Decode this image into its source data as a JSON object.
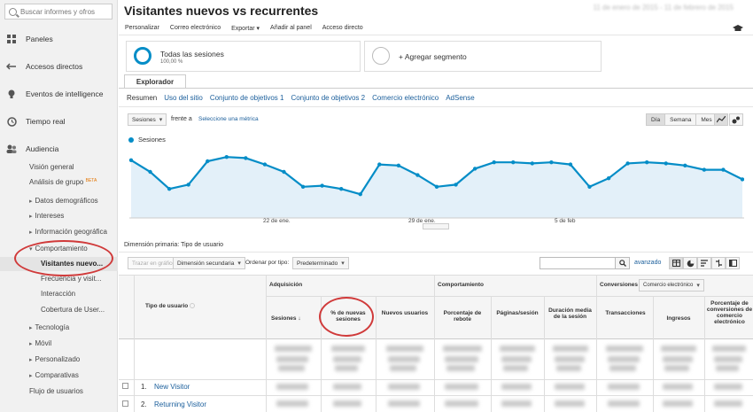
{
  "sidebar": {
    "search_placeholder": "Buscar informes y ofros",
    "items": [
      {
        "label": "Paneles",
        "icon": "grid-icon"
      },
      {
        "label": "Accesos directos",
        "icon": "shortcut-arrow-icon"
      },
      {
        "label": "Eventos de intelligence",
        "icon": "lightbulb-icon"
      },
      {
        "label": "Tiempo real",
        "icon": "clock-icon"
      },
      {
        "label": "Audiencia",
        "icon": "people-icon"
      }
    ],
    "audience_sub": {
      "overview": "Visión general",
      "cohort": "Análisis de grupo",
      "cohort_badge": "BETA",
      "demographics": "Datos demográficos",
      "interests": "Intereses",
      "geo": "Información geográfica",
      "behavior": "Comportamiento",
      "behavior_children": [
        "Visitantes nuevo...",
        "Frecuencia y visit...",
        "Interacción",
        "Cobertura de User..."
      ],
      "technology": "Tecnología",
      "mobile": "Móvil",
      "custom": "Personalizado",
      "benchmarking": "Comparativas",
      "users_flow": "Flujo de usuarios"
    }
  },
  "header": {
    "title": "Visitantes nuevos vs recurrentes",
    "date_range": "11 de enero de 2015 - 11 de febrero de 2015"
  },
  "toolbar": [
    "Personalizar",
    "Correo electrónico",
    "Exportar ▾",
    "Añadir al panel",
    "Acceso directo"
  ],
  "segments": {
    "all_sessions": "Todas las sesiones",
    "all_sessions_pct": "100,00 %",
    "add_segment": "+ Agregar segmento"
  },
  "explorer": {
    "tab": "Explorador",
    "subtabs": [
      "Resumen",
      "Uso del sitio",
      "Conjunto de objetivos 1",
      "Conjunto de objetivos 2",
      "Comercio electrónico",
      "AdSense"
    ]
  },
  "chart_controls": {
    "metric": "Sesiones",
    "versus": "frente a",
    "select_metric": "Seleccione una métrica",
    "periods": [
      "Día",
      "Semana",
      "Mes"
    ]
  },
  "chart_data": {
    "type": "area",
    "series": [
      {
        "name": "Sesiones",
        "values": [
          56,
          45,
          29,
          33,
          55,
          59,
          58,
          52,
          45,
          31,
          32,
          29,
          24,
          52,
          51,
          42,
          31,
          33,
          48,
          54,
          54,
          53,
          54,
          52,
          31,
          39,
          53,
          54,
          53,
          51,
          47,
          47,
          38
        ]
      }
    ],
    "x_labels": [
      "22 de ene.",
      "29 de ene.",
      "5 de feb"
    ],
    "color": "#058dc7",
    "fill": "#e3f0f9"
  },
  "table_controls": {
    "primary_dimension_label": "Dimensión primaria:",
    "primary_dimension_value": "Tipo de usuario",
    "plot_rows": "Trazar en gráfico",
    "secondary_dimension": "Dimensión secundaria",
    "sort_type_label": "Ordenar por tipo:",
    "sort_type_value": "Predeterminado",
    "advanced": "avanzado"
  },
  "table": {
    "dim_header": "Tipo de usuario",
    "groups": [
      "Adquisición",
      "Comportamiento",
      "Conversiones"
    ],
    "conversion_select": "Comercio electrónico",
    "columns": [
      "Sesiones",
      "% de nuevas sesiones",
      "Nuevos usuarios",
      "Porcentaje de rebote",
      "Páginas/sesión",
      "Duración media de la sesión",
      "Transacciones",
      "Ingresos",
      "Porcentaje de conversiones de comercio electrónico"
    ],
    "rows": [
      {
        "index": "1.",
        "label": "New Visitor"
      },
      {
        "index": "2.",
        "label": "Returning Visitor"
      }
    ]
  }
}
